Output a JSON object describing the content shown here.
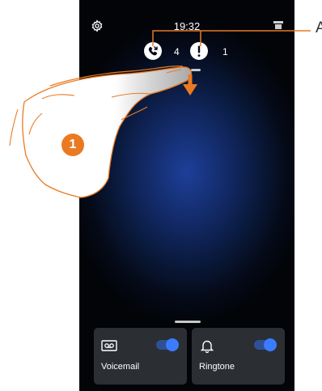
{
  "status_bar": {
    "time": "19:32",
    "settings_icon": "gear-icon",
    "device_icon": "intercom-device-icon"
  },
  "notifications": {
    "missed_calls": {
      "icon": "missed-call-icon",
      "count": "4"
    },
    "alerts": {
      "icon": "exclamation-icon",
      "count": "1"
    }
  },
  "quick_tiles": [
    {
      "label": "Voicemail",
      "icon": "voicemail-icon",
      "enabled": true
    },
    {
      "label": "Ringtone",
      "icon": "bell-icon",
      "enabled": true
    }
  ],
  "annotations": {
    "callout_label": "A",
    "step_number": "1"
  },
  "colors": {
    "accent": "#3b7bff",
    "callout_orange": "#ea7a22",
    "tile_background": "#2b2e33"
  }
}
